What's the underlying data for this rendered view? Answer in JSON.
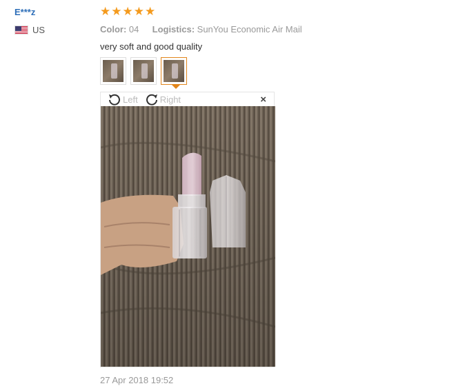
{
  "user": {
    "name": "E***z",
    "country": "US",
    "flag_icon": "us-flag-icon"
  },
  "review": {
    "rating": 5,
    "stars": [
      "★",
      "★",
      "★",
      "★",
      "★"
    ],
    "color_label": "Color:",
    "color_value": "04",
    "logistics_label": "Logistics:",
    "logistics_value": "SunYou Economic Air Mail",
    "text": "very soft and good quality",
    "thumbnails": 3,
    "active_thumbnail": 3,
    "date": "27 Apr 2018 19:52"
  },
  "viewer": {
    "rotate_left_label": "Left",
    "rotate_right_label": "Right",
    "close_label": "×"
  },
  "colors": {
    "star": "#f49a1d",
    "accent": "#e1851b",
    "username": "#2d6eb8"
  }
}
